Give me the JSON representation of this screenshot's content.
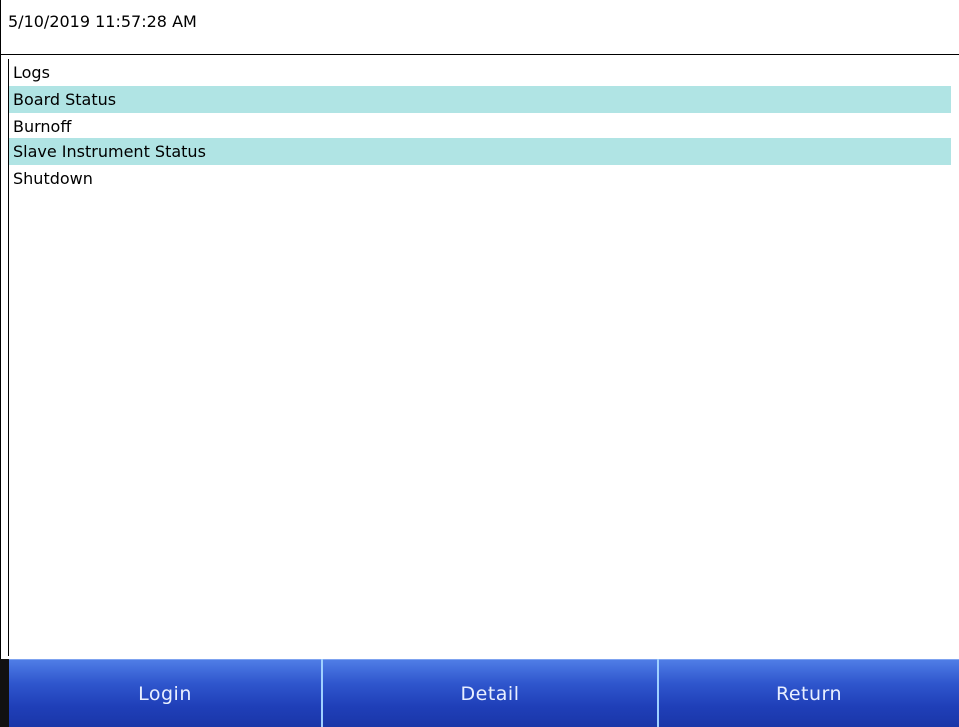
{
  "header": {
    "timestamp": "5/10/2019 11:57:28 AM"
  },
  "menu": {
    "items": [
      {
        "label": "Logs",
        "highlighted": false
      },
      {
        "label": "Board Status",
        "highlighted": true
      },
      {
        "label": "Burnoff",
        "highlighted": false
      },
      {
        "label": "Slave Instrument Status",
        "highlighted": true
      },
      {
        "label": "Shutdown",
        "highlighted": false
      }
    ],
    "highlight_color": "#b0e4e4"
  },
  "toolbar": {
    "login_label": "Login",
    "detail_label": "Detail",
    "return_label": "Return",
    "button_color": "#2f56cd"
  }
}
